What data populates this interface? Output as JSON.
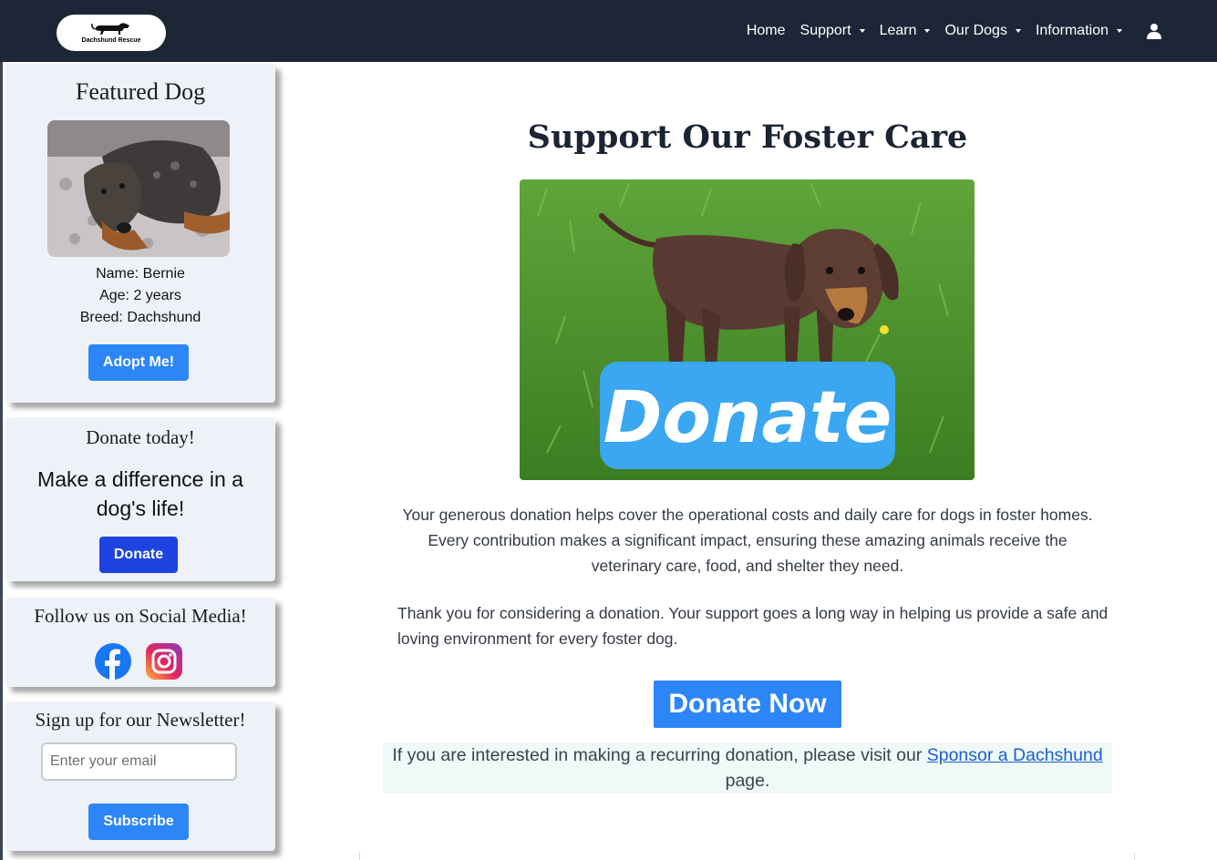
{
  "nav": {
    "logo_text": "Dachshund Rescue",
    "items": [
      {
        "label": "Home",
        "dropdown": false
      },
      {
        "label": "Support",
        "dropdown": true
      },
      {
        "label": "Learn",
        "dropdown": true
      },
      {
        "label": "Our Dogs",
        "dropdown": true
      },
      {
        "label": "Information",
        "dropdown": true
      }
    ],
    "account_icon": "user-icon"
  },
  "sidebar": {
    "featured": {
      "title": "Featured Dog",
      "name": "Name: Bernie",
      "age": "Age: 2 years",
      "breed": "Breed: Dachshund",
      "button": "Adopt Me!"
    },
    "donate": {
      "title": "Donate today!",
      "tagline": "Make a difference in a dog's life!",
      "button": "Donate"
    },
    "social": {
      "title": "Follow us on Social Media!",
      "icons": [
        "facebook-icon",
        "instagram-icon"
      ]
    },
    "newsletter": {
      "title": "Sign up for our Newsletter!",
      "placeholder": "Enter your email",
      "button": "Subscribe"
    }
  },
  "main": {
    "title": "Support Our Foster Care",
    "hero_text": "Donate",
    "para1": "Your generous donation helps cover the operational costs and daily care for dogs in foster homes. Every contribution makes a significant impact, ensuring these amazing animals receive the veterinary care, food, and shelter they need.",
    "para2": "Thank you for considering a donation. Your support goes a long way in helping us provide a safe and loving environment for every foster dog.",
    "donate_button": "Donate Now",
    "recurring_prefix": "If you are interested in making a recurring donation, please visit our",
    "recurring_link": "Sponsor a Dachshund",
    "recurring_suffix": "page."
  },
  "colors": {
    "navbar": "#1c2636",
    "primary_button": "#2d86f7",
    "sidebar_donate_button": "#1d44e0",
    "card_bg": "#eef2f8",
    "recurring_bg": "#eff9f7"
  }
}
